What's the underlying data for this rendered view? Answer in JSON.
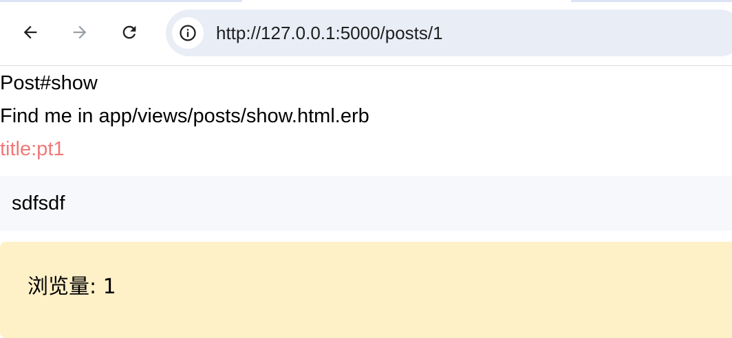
{
  "browser": {
    "url": "http://127.0.0.1:5000/posts/1",
    "back_icon": "arrow-left-icon",
    "forward_icon": "arrow-right-icon",
    "reload_icon": "reload-icon",
    "site_info_icon": "info-icon"
  },
  "page": {
    "heading": "Post#show",
    "hint": "Find me in app/views/posts/show.html.erb",
    "title_line": "title:pt1",
    "body": "sdfsdf",
    "views_line": "浏览量: 1"
  },
  "colors": {
    "title_color": "#f07878",
    "views_bg": "#fef0c7",
    "body_bg": "#f7f8fb",
    "omnibox_bg": "#e9edf6"
  }
}
